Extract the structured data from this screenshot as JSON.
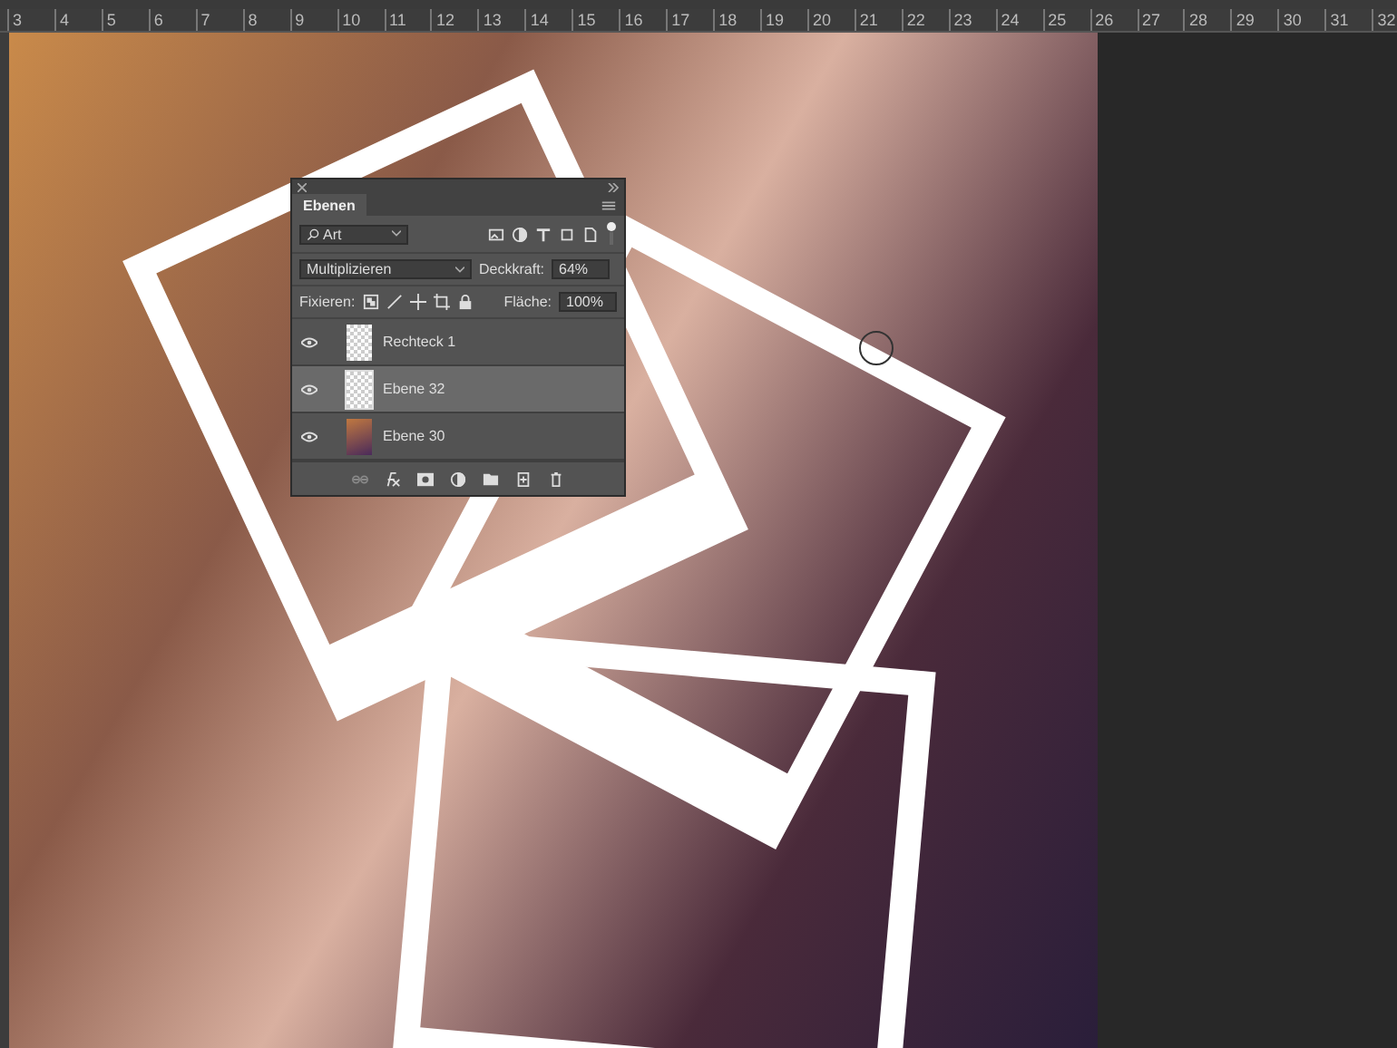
{
  "ruler": {
    "marks": [
      "3",
      "4",
      "5",
      "6",
      "7",
      "8",
      "9",
      "10",
      "11",
      "12",
      "13",
      "14",
      "15",
      "16",
      "17",
      "18",
      "19",
      "20",
      "21",
      "22",
      "23",
      "24",
      "25",
      "26",
      "27",
      "28",
      "29",
      "30",
      "31",
      "32"
    ]
  },
  "layers_panel": {
    "tab": "Ebenen",
    "filter": {
      "value": "Art"
    },
    "blend_mode": "Multiplizieren",
    "opacity_label": "Deckkraft:",
    "opacity": "64%",
    "lock_label": "Fixieren:",
    "fill_label": "Fläche:",
    "fill": "100%",
    "layers": [
      {
        "name": "Rechteck 1",
        "visible": true,
        "selected": false,
        "kind": "transparent"
      },
      {
        "name": "Ebene 32",
        "visible": true,
        "selected": true,
        "kind": "transparent"
      },
      {
        "name": "Ebene 30",
        "visible": true,
        "selected": false,
        "kind": "photo"
      }
    ]
  }
}
